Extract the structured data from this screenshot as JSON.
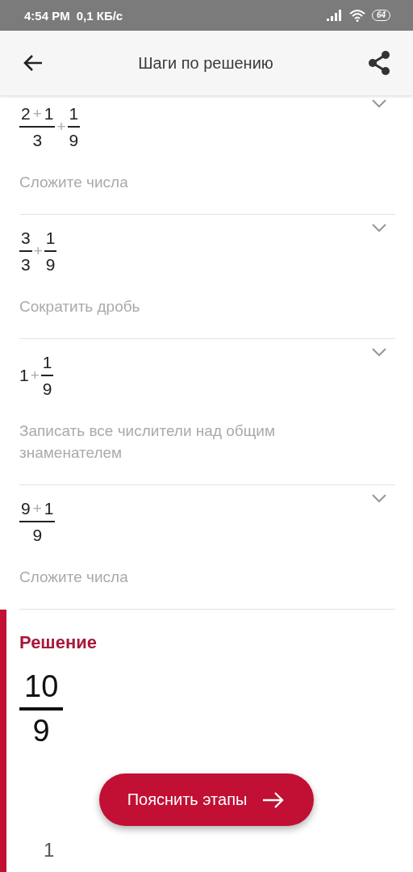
{
  "status_bar": {
    "time": "4:54 PM",
    "speed": "0,1 КБ/с",
    "battery": "64"
  },
  "app_bar": {
    "title": "Шаги по решению"
  },
  "steps": [
    {
      "expanded": false,
      "expression": [
        {
          "kind": "fraction",
          "numerator": [
            {
              "kind": "number",
              "text": "2"
            },
            {
              "kind": "operator",
              "text": "+"
            },
            {
              "kind": "number",
              "text": "1"
            }
          ],
          "denominator": [
            {
              "kind": "number",
              "text": "3"
            }
          ]
        },
        {
          "kind": "operator",
          "text": "+"
        },
        {
          "kind": "fraction",
          "numerator": [
            {
              "kind": "number",
              "text": "1"
            }
          ],
          "denominator": [
            {
              "kind": "number",
              "text": "9"
            }
          ]
        }
      ],
      "description": "Сложите числа"
    },
    {
      "expanded": false,
      "expression": [
        {
          "kind": "fraction",
          "numerator": [
            {
              "kind": "number",
              "text": "3"
            }
          ],
          "denominator": [
            {
              "kind": "number",
              "text": "3"
            }
          ]
        },
        {
          "kind": "operator",
          "text": "+"
        },
        {
          "kind": "fraction",
          "numerator": [
            {
              "kind": "number",
              "text": "1"
            }
          ],
          "denominator": [
            {
              "kind": "number",
              "text": "9"
            }
          ]
        }
      ],
      "description": "Сократить дробь"
    },
    {
      "expanded": false,
      "expression": [
        {
          "kind": "number",
          "text": "1"
        },
        {
          "kind": "operator",
          "text": "+"
        },
        {
          "kind": "fraction",
          "numerator": [
            {
              "kind": "number",
              "text": "1"
            }
          ],
          "denominator": [
            {
              "kind": "number",
              "text": "9"
            }
          ]
        }
      ],
      "description": "Записать все числители над общим знаменателем"
    },
    {
      "expanded": false,
      "expression": [
        {
          "kind": "fraction",
          "numerator": [
            {
              "kind": "number",
              "text": "9"
            },
            {
              "kind": "operator",
              "text": "+"
            },
            {
              "kind": "number",
              "text": "1"
            }
          ],
          "denominator": [
            {
              "kind": "number",
              "text": "9"
            }
          ]
        }
      ],
      "description": "Сложите числа"
    }
  ],
  "solution": {
    "title": "Решение",
    "result": {
      "numerator": "10",
      "denominator": "9"
    },
    "next_line": "1"
  },
  "explain_button": {
    "label": "Пояснить этапы"
  }
}
